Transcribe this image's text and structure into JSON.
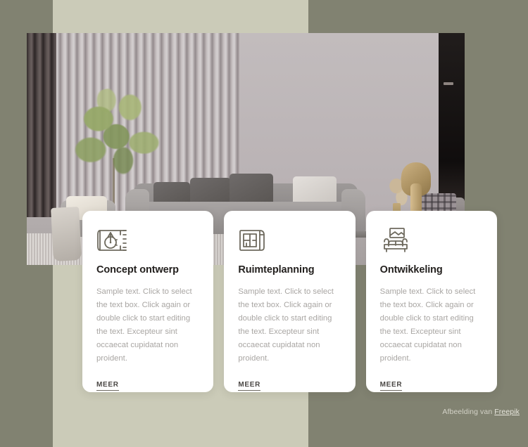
{
  "theme": {
    "background_dark": "#818271",
    "background_light": "#cbcbb8",
    "card_background": "#ffffff",
    "title_color": "#23201e",
    "body_color": "#a9a6a3",
    "icon_color": "#6e6a5e",
    "link_color": "#4a4744"
  },
  "hero": {
    "alt": "Modern living room interior with grey sectional sofa, slatted wall, olive tree and brass mushroom lamp"
  },
  "cards": [
    {
      "icon": "blueprint-compass-icon",
      "title": "Concept ontwerp",
      "body": "Sample text. Click to select the text box. Click again or double click to start editing the text. Excepteur sint occaecat cupidatat non proident.",
      "link_label": "MEER"
    },
    {
      "icon": "floor-plan-icon",
      "title": "Ruimteplanning",
      "body": "Sample text. Click to select the text box. Click again or double click to start editing the text. Excepteur sint occaecat cupidatat non proident.",
      "link_label": "MEER"
    },
    {
      "icon": "sofa-icon",
      "title": "Ontwikkeling",
      "body": "Sample text. Click to select the text box. Click again or double click to start editing the text. Excepteur sint occaecat cupidatat non proident.",
      "link_label": "MEER"
    }
  ],
  "credit": {
    "prefix": "Afbeelding van ",
    "link_label": "Freepik"
  }
}
